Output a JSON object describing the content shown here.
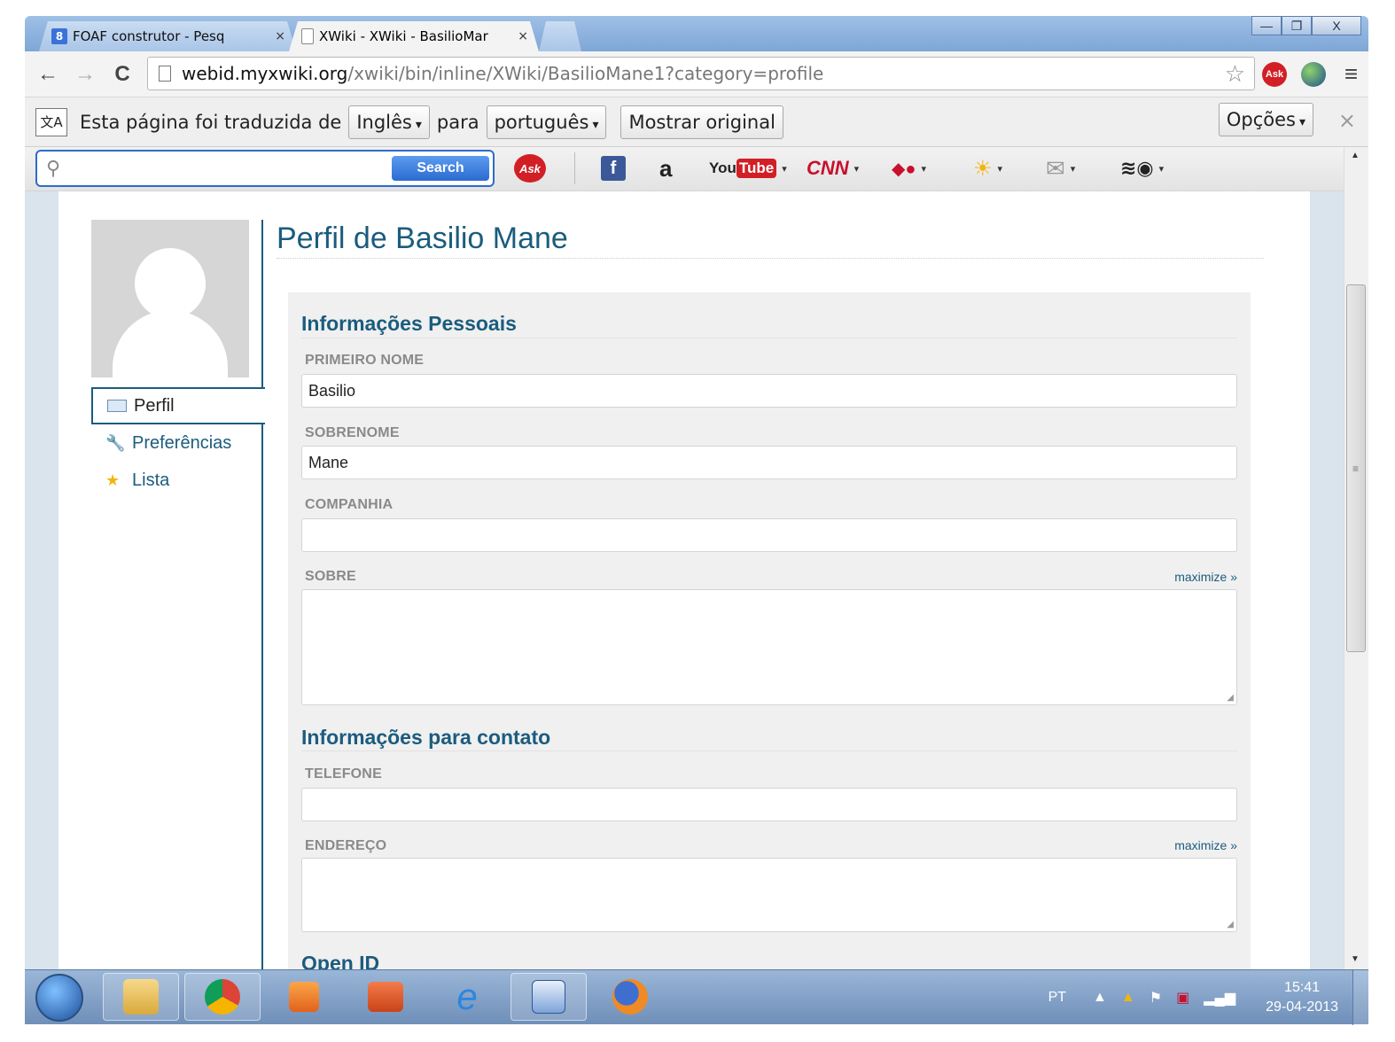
{
  "browser": {
    "tabs": [
      {
        "title": "FOAF construtor - Pesq",
        "icon": "google-search-icon",
        "close": "×",
        "active": false
      },
      {
        "title": "XWiki - XWiki - BasilioMar",
        "icon": "page-icon",
        "close": "×",
        "active": true
      }
    ],
    "window_controls": {
      "minimize": "—",
      "maximize": "❐",
      "close": "X"
    },
    "nav": {
      "back": "←",
      "forward": "→",
      "reload": "C"
    },
    "address": {
      "host": "webid.myxwiki.org",
      "path": "/xwiki/bin/inline/XWiki/BasilioMane1?category=profile"
    }
  },
  "translate_bar": {
    "text_before": "Esta página foi traduzida de",
    "from_lang": "Inglês",
    "text_mid": "para",
    "to_lang": "português",
    "show_original": "Mostrar original",
    "options": "Opções",
    "close": "×"
  },
  "ask_toolbar": {
    "search_button": "Search",
    "ask_label": "Ask",
    "facebook_label": "f",
    "amazon_label": "a",
    "youtube_label_you": "You",
    "youtube_label_tube": "Tube",
    "cnn_label": "CNN"
  },
  "sidebar": {
    "items": [
      {
        "label": "Perfil",
        "icon": "profile-card-icon",
        "active": true
      },
      {
        "label": "Preferências",
        "icon": "wrench-icon",
        "active": false
      },
      {
        "label": "Lista",
        "icon": "star-icon",
        "active": false
      }
    ]
  },
  "main": {
    "title": "Perfil de Basilio Mane",
    "sections": {
      "personal": "Informações Pessoais",
      "contact": "Informações para contato",
      "openid": "Open ID"
    },
    "fields": {
      "first_name": {
        "label": "PRIMEIRO NOME",
        "value": "Basilio"
      },
      "last_name": {
        "label": "SOBRENOME",
        "value": "Mane"
      },
      "company": {
        "label": "COMPANHIA",
        "value": ""
      },
      "about": {
        "label": "SOBRE",
        "value": "",
        "maximize": "maximize »"
      },
      "phone": {
        "label": "TELEFONE",
        "value": ""
      },
      "address": {
        "label": "ENDEREÇO",
        "value": "",
        "maximize": "maximize »"
      }
    }
  },
  "taskbar": {
    "language": "PT",
    "time": "15:41",
    "date": "29-04-2013"
  },
  "colors": {
    "accent": "#1b5c7e",
    "label": "#8a8a8a",
    "panel": "#f0f0f0"
  }
}
